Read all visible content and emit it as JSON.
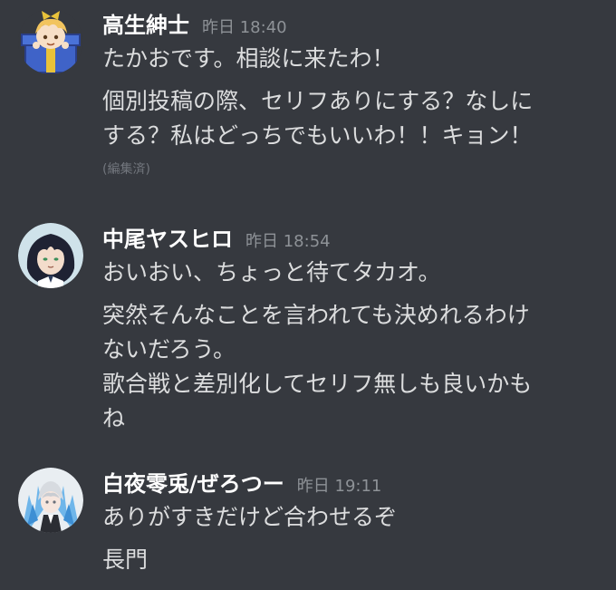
{
  "messages": [
    {
      "username": "高生紳士",
      "timestamp": "昨日 18:40",
      "lines": [
        "たかおです。相談に来たわ！",
        "個別投稿の際、セリフありにする？なしに",
        "する？私はどっちでもいいわ！！キョン！"
      ],
      "edited": "(編集済)",
      "avatar_icon": "present-box-avatar"
    },
    {
      "username": "中尾ヤスヒロ",
      "timestamp": "昨日 18:54",
      "lines": [
        "おいおい、ちょっと待てタカオ。",
        "突然そんなことを言われても決めれるわけ",
        "ないだろう。",
        "歌合戦と差別化してセリフ無しも良いかも",
        "ね"
      ],
      "avatar_icon": "dark-hair-avatar"
    },
    {
      "username": "白夜零兎/ぜろつー",
      "timestamp": "昨日 19:11",
      "lines": [
        "ありがすきだけど合わせるぞ",
        "長門"
      ],
      "avatar_icon": "white-hair-avatar"
    }
  ],
  "colors": {
    "background": "#36393f",
    "username": "#ffffff",
    "text": "#dcddde",
    "timestamp": "#8e9297",
    "edited": "#72767d"
  }
}
